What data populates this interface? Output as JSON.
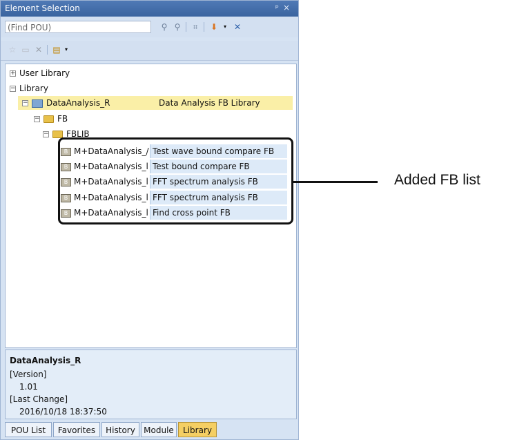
{
  "panel": {
    "title": "Element Selection",
    "pin_glyph": "ᵖ",
    "close_glyph": "×"
  },
  "find": {
    "placeholder": "(Find POU)"
  },
  "toolbar": {
    "icons": [
      "binoculars-icon",
      "binoculars-next-icon",
      "tree-icon",
      "export-icon",
      "remove-icon"
    ],
    "fav_icons": [
      "star-icon",
      "folder-icon",
      "delete-icon",
      "lib-icon"
    ]
  },
  "tree": {
    "user_library": "User Library",
    "library": "Library",
    "lib_name": "DataAnalysis_R",
    "lib_comment": "Data Analysis FB Library",
    "fb": "FB",
    "fblib": "FBLIB",
    "fb_items": [
      {
        "name": "M+DataAnalysis_/",
        "comment": "Test wave bound compare FB"
      },
      {
        "name": "M+DataAnalysis_l",
        "comment": "Test bound compare FB"
      },
      {
        "name": "M+DataAnalysis_l",
        "comment": "FFT spectrum analysis FB"
      },
      {
        "name": "M+DataAnalysis_l",
        "comment": "FFT spectrum analysis FB"
      },
      {
        "name": "M+DataAnalysis_l",
        "comment": "Find cross point FB"
      }
    ]
  },
  "info": {
    "name": "DataAnalysis_R",
    "version_label": "[Version]",
    "version": "1.01",
    "last_change_label": "[Last Change]",
    "last_change": "2016/10/18 18:37:50"
  },
  "tabs": [
    "POU List",
    "Favorites",
    "History",
    "Module",
    "Library"
  ],
  "active_tab": "Library",
  "callout": {
    "label": "Added FB list"
  },
  "colors": {
    "titlebar": "#3a649f",
    "highlight": "#faefa7",
    "active_tab": "#f5cf63"
  }
}
